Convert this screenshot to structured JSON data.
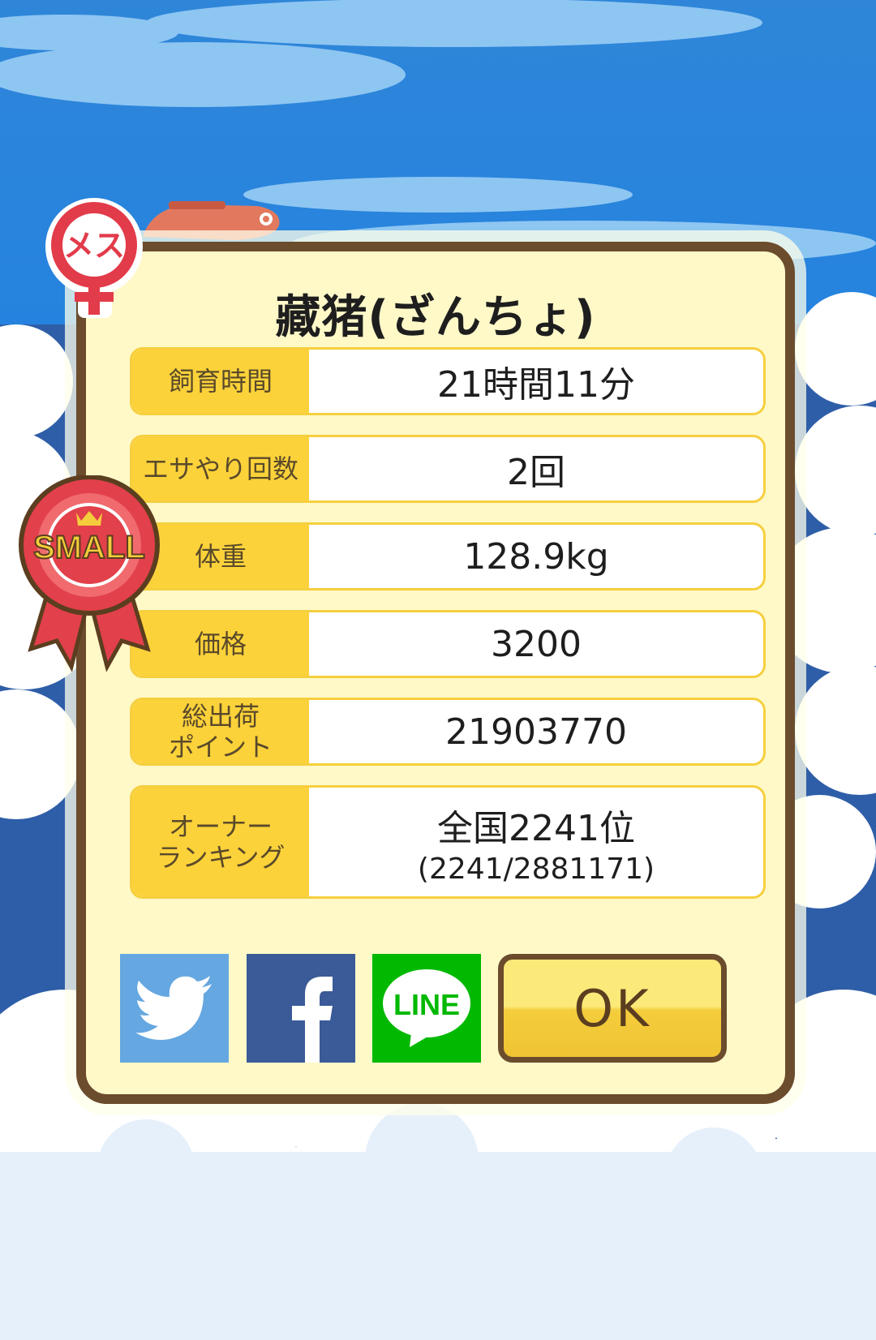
{
  "dialog": {
    "title": "藏猪(ざんちょ)",
    "rows": [
      {
        "label": "飼育時間",
        "value": "21時間11分"
      },
      {
        "label": "エサやり回数",
        "value": "2回"
      },
      {
        "label": "体重",
        "value": "128.9kg"
      },
      {
        "label": "価格",
        "value": "3200"
      },
      {
        "label": "総出荷\nポイント",
        "value": "21903770"
      },
      {
        "label": "オーナー\nランキング",
        "value": "全国2241位",
        "sub": "(2241/2881171)"
      }
    ]
  },
  "badges": {
    "gender": "メス",
    "size_award": "SMALL"
  },
  "share": {
    "twitter_icon": "twitter-bird-icon",
    "facebook_icon": "facebook-f-icon",
    "line_icon": "line-icon",
    "line_label": "LINE"
  },
  "ok_label": "OK",
  "colors": {
    "sky": "#2e8de0",
    "panel": "#fff9c8",
    "border": "#6b4c2c",
    "label_bg": "#fcd23a",
    "twitter": "#65a7e0",
    "facebook": "#3a5a98",
    "line": "#00b900"
  }
}
